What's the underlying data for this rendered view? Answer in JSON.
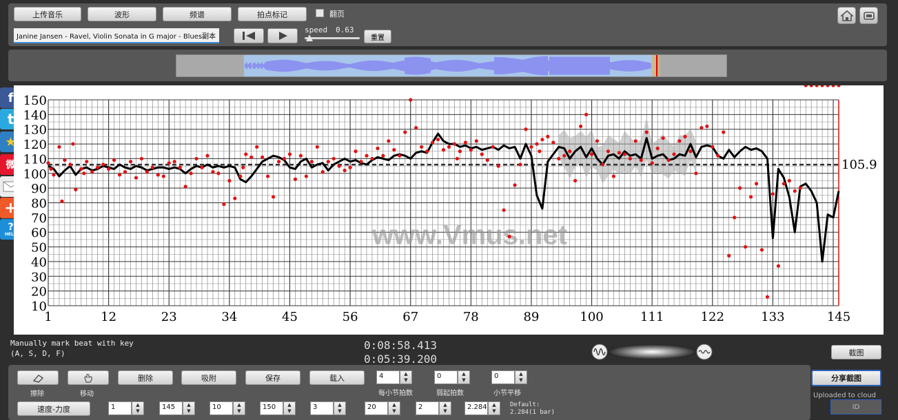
{
  "toolbar": {
    "upload_music": "上传音乐",
    "waveform": "波形",
    "spectrum": "频谱",
    "tap_mark": "拍点标记",
    "page_flip": "翻页",
    "page_flip_checked": false
  },
  "player": {
    "song_title": "Janine Jansen - Ravel, Violin Sonata in G major - Blues副本",
    "speed_label": "speed",
    "speed_value": "0.63",
    "reset_label": "重置"
  },
  "header_icons": [
    "home-icon",
    "fullscreen-icon"
  ],
  "social_icons": [
    "facebook-icon",
    "twitter-icon",
    "favorite-star-icon",
    "weibo-icon",
    "mail-icon",
    "add-icon",
    "help-icon"
  ],
  "help_text": "HELP",
  "chart_data": {
    "type": "line",
    "watermark": "www.Vmus.net",
    "x_ticks": [
      "1",
      "12",
      "23",
      "34",
      "45",
      "56",
      "67",
      "78",
      "89",
      "100",
      "111",
      "122",
      "133",
      "145"
    ],
    "y_ticks": [
      "150",
      "140",
      "130",
      "120",
      "110",
      "100",
      "90",
      "80",
      "70",
      "60",
      "50",
      "40",
      "30",
      "20",
      "10"
    ],
    "xlim": [
      1,
      145
    ],
    "ylim": [
      10,
      150
    ],
    "mean_value": 105.9,
    "mean_label": "105.9",
    "smooth_color": "#000000",
    "point_color": "#e11111",
    "smooth_series": {
      "x": [
        1,
        2,
        3,
        4,
        5,
        6,
        7,
        8,
        9,
        10,
        11,
        12,
        13,
        14,
        15,
        16,
        17,
        18,
        19,
        20,
        21,
        22,
        23,
        24,
        25,
        26,
        27,
        28,
        29,
        30,
        31,
        32,
        33,
        34,
        35,
        36,
        37,
        38,
        39,
        40,
        41,
        42,
        43,
        44,
        45,
        46,
        47,
        48,
        49,
        50,
        51,
        52,
        53,
        54,
        55,
        56,
        57,
        58,
        59,
        60,
        61,
        62,
        63,
        64,
        65,
        66,
        67,
        68,
        69,
        70,
        71,
        72,
        73,
        74,
        75,
        76,
        77,
        78,
        79,
        80,
        81,
        82,
        83,
        84,
        85,
        86,
        87,
        88,
        89,
        90,
        91,
        92,
        93,
        94,
        95,
        96,
        97,
        98,
        99,
        100,
        101,
        102,
        103,
        104,
        105,
        106,
        107,
        108,
        109,
        110,
        111,
        112,
        113,
        114,
        115,
        116,
        117,
        118,
        119,
        120,
        121,
        122,
        123,
        124,
        125,
        126,
        127,
        128,
        129,
        130,
        131,
        132,
        133,
        134,
        135,
        136,
        137,
        138,
        139,
        140,
        141,
        142,
        143,
        144,
        145
      ],
      "y": [
        105,
        103,
        98,
        102,
        105,
        99,
        103,
        104,
        102,
        103,
        105,
        104,
        103,
        106,
        104,
        103,
        105,
        104,
        102,
        103,
        104,
        104,
        103,
        104,
        103,
        100,
        103,
        105,
        104,
        106,
        104,
        105,
        104,
        105,
        104,
        96,
        94,
        98,
        103,
        108,
        110,
        112,
        111,
        109,
        104,
        103,
        108,
        110,
        104,
        106,
        107,
        102,
        106,
        108,
        110,
        108,
        109,
        107,
        106,
        109,
        111,
        110,
        109,
        112,
        113,
        112,
        110,
        114,
        115,
        114,
        121,
        127,
        122,
        120,
        120,
        118,
        119,
        117,
        118,
        116,
        117,
        118,
        116,
        119,
        117,
        118,
        110,
        120,
        112,
        85,
        76,
        108,
        113,
        118,
        117,
        110,
        115,
        118,
        111,
        117,
        110,
        106,
        112,
        113,
        110,
        115,
        112,
        113,
        110,
        124,
        110,
        112,
        113,
        109,
        110,
        113,
        112,
        120,
        111,
        118,
        119,
        118,
        112,
        110,
        116,
        111,
        115,
        118,
        116,
        117,
        115,
        110,
        56,
        103,
        97,
        84,
        60,
        91,
        93,
        88,
        80,
        40,
        72,
        70,
        88,
        91,
        92
      ],
      "note": "visible smoothed tempo curve (BPM) per measure"
    },
    "scatter_series": {
      "x": [
        1,
        1.5,
        2,
        3,
        3.5,
        4,
        5,
        5.5,
        6,
        7,
        7.5,
        8,
        9,
        10,
        11,
        12,
        13,
        14,
        15,
        16,
        17,
        18,
        19,
        20,
        21,
        22,
        23,
        24,
        25,
        26,
        27,
        28,
        29,
        30,
        31,
        32,
        33,
        34,
        35,
        36,
        36.5,
        37,
        38,
        39,
        40,
        41,
        42,
        43,
        44,
        45,
        46,
        47,
        48,
        49,
        50,
        51,
        52,
        53,
        54,
        55,
        56,
        57,
        58,
        59,
        60,
        61,
        62,
        63,
        64,
        65,
        66,
        67,
        68,
        69,
        70,
        71,
        72,
        73,
        74,
        75,
        75.5,
        76,
        77,
        78,
        79,
        80,
        81,
        82,
        83,
        84,
        85,
        86,
        87,
        88,
        89,
        90,
        90.5,
        91,
        92,
        93,
        94,
        95,
        96,
        97,
        98,
        99,
        100,
        101,
        102,
        103,
        104,
        105,
        106,
        107,
        108,
        109,
        110,
        111,
        112,
        113,
        114,
        115,
        116,
        117,
        118,
        119,
        120,
        121,
        122,
        123,
        124,
        125,
        126,
        127,
        128,
        129,
        130,
        131,
        132,
        133,
        134,
        135,
        136,
        137,
        138,
        139,
        140,
        141,
        142,
        143,
        144,
        145
      ],
      "y": [
        107,
        103,
        99,
        118,
        81,
        109,
        106,
        120,
        89,
        103,
        100,
        108,
        101,
        104,
        106,
        103,
        109,
        99,
        101,
        108,
        97,
        110,
        101,
        104,
        99,
        98,
        107,
        108,
        104,
        91,
        100,
        110,
        104,
        112,
        101,
        100,
        79,
        95,
        83,
        98,
        104,
        113,
        111,
        118,
        111,
        98,
        84,
        108,
        110,
        113,
        96,
        112,
        98,
        108,
        118,
        101,
        108,
        110,
        105,
        102,
        104,
        115,
        108,
        112,
        110,
        117,
        112,
        122,
        116,
        112,
        128,
        150,
        131,
        118,
        115,
        121,
        123,
        116,
        118,
        120,
        110,
        115,
        121,
        116,
        122,
        113,
        109,
        118,
        105,
        75,
        57,
        92,
        106,
        130,
        118,
        120,
        115,
        123,
        125,
        121,
        110,
        112,
        115,
        95,
        132,
        140,
        113,
        122,
        106,
        115,
        98,
        114,
        113,
        110,
        122,
        109,
        128,
        107,
        117,
        124,
        109,
        113,
        122,
        125,
        115,
        100,
        131,
        132,
        118,
        112,
        128,
        44,
        70,
        90,
        50,
        84,
        93,
        48,
        16,
        86,
        37,
        93,
        95,
        88,
        90
      ],
      "note": "individual beat tempo dots (approximate)"
    },
    "variance_band": {
      "x_start": 94,
      "x_end": 119,
      "note": "grey confidence band shown"
    }
  },
  "status": {
    "beat_hint_line1": "Manually mark beat with key",
    "beat_hint_line2": "(A, S, D, F)",
    "time_total": "0:08:58.413",
    "time_current": "0:05:39.200",
    "screenshot_label": "截图"
  },
  "bottom": {
    "erase_label": "擦除",
    "move_label": "移动",
    "delete_label": "删除",
    "snap_label": "吸附",
    "save_label": "保存",
    "load_label": "载入",
    "beats_per_bar_value": "4",
    "beats_per_bar_label": "每小节拍数",
    "pickup_value": "0",
    "pickup_label": "弱起拍数",
    "bar_shift_value": "0",
    "bar_shift_label": "小节平移",
    "tempo_dynamics_label": "速度-力度",
    "params": [
      "1",
      "145",
      "10",
      "150",
      "3",
      "20",
      "2",
      "2.284"
    ],
    "default_line1": "Default:",
    "default_line2": "2.284(1 bar)",
    "share_label": "分享截图",
    "uploaded_label": "Uploaded to cloud",
    "id_label": "ID"
  }
}
